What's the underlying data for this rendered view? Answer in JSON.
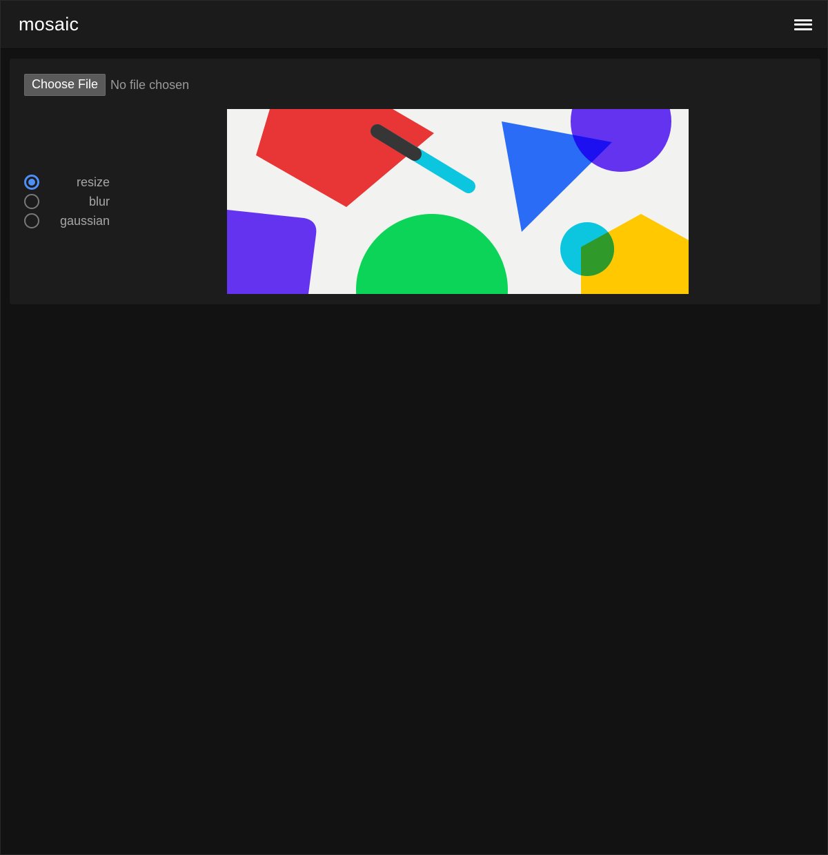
{
  "app": {
    "title": "mosaic",
    "menu_icon": "hamburger-menu-icon"
  },
  "upload": {
    "button_label": "Choose File",
    "status_text": "No file chosen"
  },
  "modes": [
    {
      "label": "resize",
      "selected": true
    },
    {
      "label": "blur",
      "selected": false
    },
    {
      "label": "gaussian",
      "selected": false
    }
  ],
  "colors": {
    "accent": "#4d8ef7",
    "background": "#121212",
    "panel": "#1c1c1c",
    "shape_red": "#e83535",
    "shape_blue": "#2a6cf5",
    "shape_purple": "#6433f0",
    "shape_green": "#0bd458",
    "shape_cyan": "#0cc6e0",
    "shape_yellow": "#ffc800"
  }
}
